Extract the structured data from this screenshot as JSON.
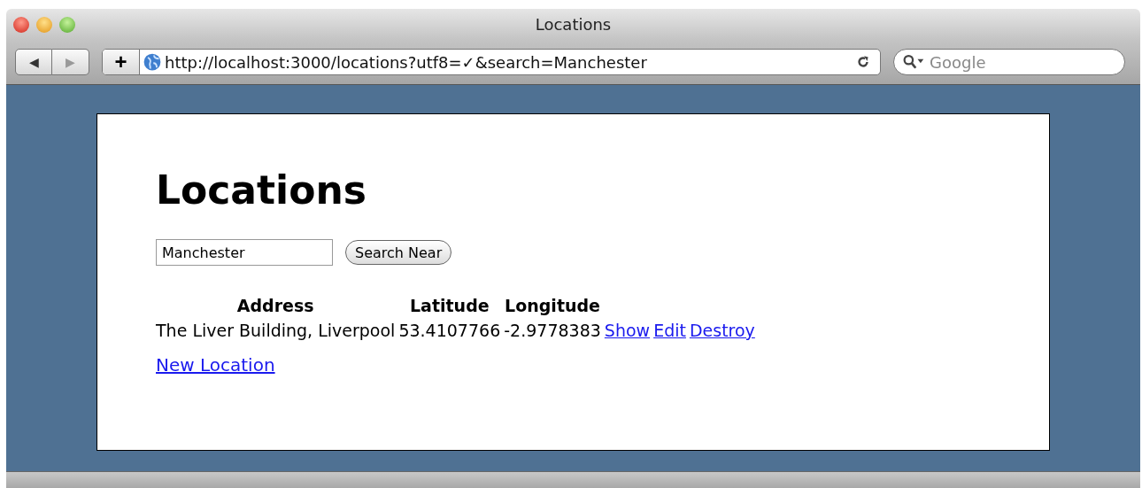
{
  "window": {
    "title": "Locations"
  },
  "toolbar": {
    "back": "◀",
    "forward": "▶",
    "add": "+",
    "url": "http://localhost:3000/locations?utf8=✓&search=Manchester",
    "search": {
      "placeholder": "Google"
    }
  },
  "page": {
    "heading": "Locations",
    "search_field": {
      "value": "Manchester"
    },
    "search_button": "Search Near",
    "table": {
      "columns": [
        "Address",
        "Latitude",
        "Longitude"
      ],
      "rows": [
        {
          "cells": [
            "The Liver Building, Liverpool",
            "53.4107766",
            "-2.9778383"
          ],
          "links": [
            "Show",
            "Edit",
            "Destroy"
          ]
        }
      ]
    },
    "new_link": "New Location"
  }
}
